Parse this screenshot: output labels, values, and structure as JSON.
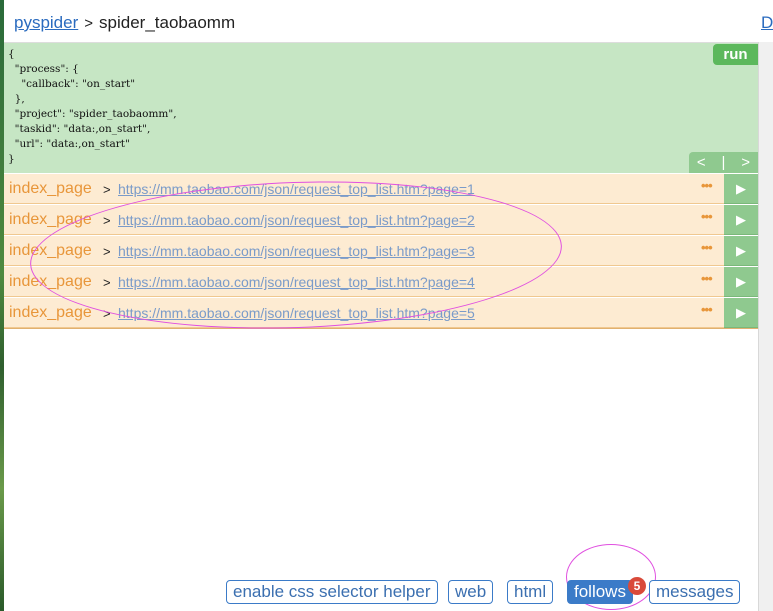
{
  "header": {
    "home_link": "pyspider",
    "separator": ">",
    "project": "spider_taobaomm",
    "right_link": "D"
  },
  "task": {
    "json_lines": [
      "{",
      "  \"process\": {",
      "    \"callback\": \"on_start\"",
      "  },",
      "  \"project\": \"spider_taobaomm\",",
      "  \"taskid\": \"data:,on_start\",",
      "  \"url\": \"data:,on_start\"",
      "}"
    ],
    "run_label": "run",
    "nav_prev": "<",
    "nav_sep": "|",
    "nav_next": ">"
  },
  "follows": [
    {
      "callback": "index_page",
      "arrow": ">",
      "url": "https://mm.taobao.com/json/request_top_list.htm?page=1",
      "more": "•••",
      "play": "▶"
    },
    {
      "callback": "index_page",
      "arrow": ">",
      "url": "https://mm.taobao.com/json/request_top_list.htm?page=2",
      "more": "•••",
      "play": "▶"
    },
    {
      "callback": "index_page",
      "arrow": ">",
      "url": "https://mm.taobao.com/json/request_top_list.htm?page=3",
      "more": "•••",
      "play": "▶"
    },
    {
      "callback": "index_page",
      "arrow": ">",
      "url": "https://mm.taobao.com/json/request_top_list.htm?page=4",
      "more": "•••",
      "play": "▶"
    },
    {
      "callback": "index_page",
      "arrow": ">",
      "url": "https://mm.taobao.com/json/request_top_list.htm?page=5",
      "more": "•••",
      "play": "▶"
    }
  ],
  "tabs": {
    "css_helper": "enable css selector helper",
    "web": "web",
    "html": "html",
    "follows": "follows",
    "follows_count": "5",
    "messages": "messages"
  },
  "colors": {
    "task_bg": "#c6e6c4",
    "run_button": "#5cb85c",
    "follow_row_bg": "#fdebd2",
    "callback_text": "#e8963a",
    "active_tab": "#3b7bc8",
    "badge": "#d94a3a",
    "annotation": "#e050e0"
  }
}
